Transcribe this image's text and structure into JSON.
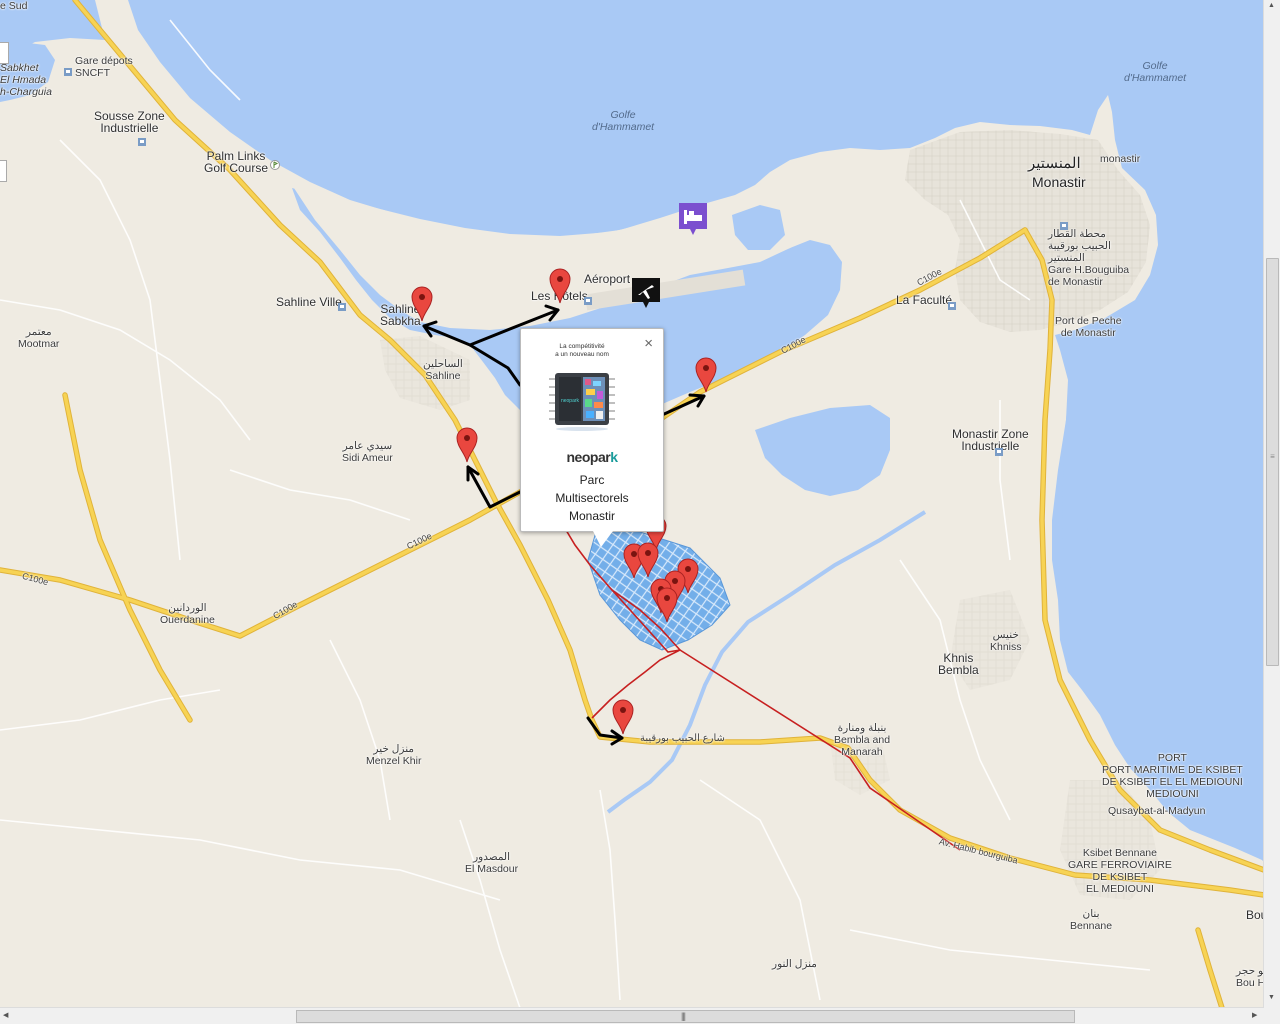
{
  "map": {
    "places": {
      "sud": "e Sud",
      "sabkhet": "Sabkhet\nEl Hmada\nh-Charguia",
      "gare_depots": "Gare dépots\nSNCFT",
      "sousse_zone": "Sousse Zone\nIndustrielle",
      "palm_links": "Palm Links\nGolf Course",
      "golfe1": "Golfe\nd'Hammamet",
      "golfe2": "Golfe\nd'Hammamet",
      "monastir_ar": "المنستير",
      "monastir": "Monastir",
      "monastir_small": "monastir",
      "gare_bourguiba": "محطة القطار\nالحبيب بورقيبة\nالمنستير\nGare H.Bouguiba\nde Monastir",
      "aeroport": "Aéroport",
      "les_hotels": "Les Hôtels",
      "la_faculte": "La Faculté",
      "port_peche": "Port de Peche\nde Monastir",
      "sahline_ville": "Sahline Ville",
      "sahline_sabkha": "Sahline\nSabkha",
      "sahline": "الساحلين\nSahline",
      "mootmar": "معتمر\nMootmar",
      "sidi_ameur": "سيدي عامر\nSidi Ameur",
      "monastir_zone": "Monastir Zone\nIndustrielle",
      "ouerdanine": "الوردانين\nOuerdanine",
      "khniss": "خنيس\nKhniss",
      "khnis_bembla": "Khnis\nBembla",
      "bembla_manarah": "بنبلة ومنارة\nBembla and\nManarah",
      "menzel_khir": "منزل خير\nMenzel Khir",
      "port_ksibet": "PORT\nPORT MARITIME DE KSIBET\nDE KSIBET EL EL MEDIOUNI\nMEDIOUNI",
      "qusaybat": "Qusaybat-al-Madyun",
      "ksibet_bennane": "Ksibet Bennane\nGARE FERROVIAIRE\nDE KSIBET\nEL MEDIOUNI",
      "el_masdour": "المصدور\nEl Masdour",
      "bennane": "بنان\nBennane",
      "menzel_nour": "منزل النور",
      "bou": "Bou",
      "bou_hjar": "بو حجر\nBou H",
      "c100e_1": "C100e",
      "c100e_2": "C100e",
      "c100e_3": "C100e",
      "c100e_4": "C100e",
      "av_habib": "Av. Habib bourguiba",
      "avenue_ar": "شارع الحبيب بورقيبة"
    },
    "icons": {
      "airport": "airport-icon",
      "hotel": "hotel-icon",
      "rail": "rail-icon",
      "golf": "golf-icon",
      "marker": "map-marker-icon",
      "close": "close-icon"
    },
    "colors": {
      "water": "#a9c9f5",
      "land": "#efebe2",
      "highway": "#f7d354",
      "highway_edge": "#e0b33a",
      "marker": "#e9473f",
      "route_red": "#c72020",
      "arrow": "#000000",
      "park_blue": "#62a5e8"
    }
  },
  "infowindow": {
    "tagline": "La compétitivité\na un nouveau nom",
    "logo_main": "neopar",
    "logo_k": "k",
    "title": "Parc\nMultisectorels\nMonastir",
    "close": "×"
  },
  "scrollbars": {
    "v_grip": "≡",
    "h_grip": "|||",
    "up": "▲",
    "down": "▼",
    "left": "◀",
    "right": "▶"
  }
}
